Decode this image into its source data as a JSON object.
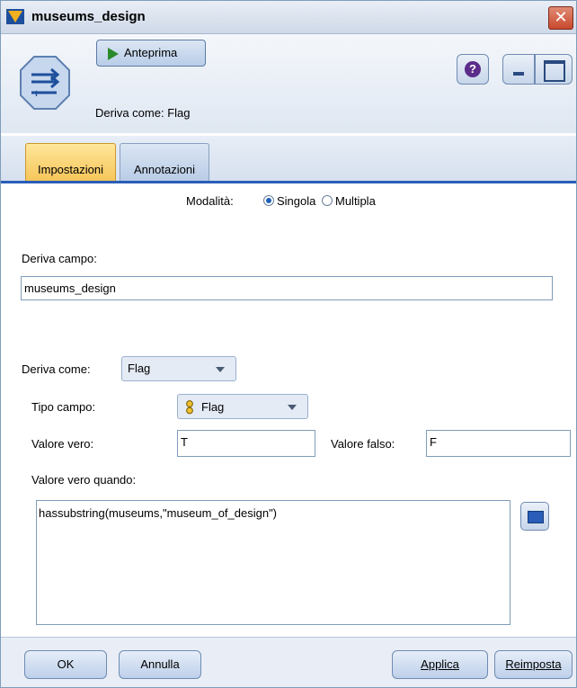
{
  "window": {
    "title": "museums_design",
    "close_symbol": "✕"
  },
  "toolbar": {
    "preview_label": "Anteprima",
    "help_symbol": "?",
    "derive_info": "Deriva come: Flag"
  },
  "tabs": [
    {
      "label": "Impostazioni",
      "active": true
    },
    {
      "label": "Annotazioni",
      "active": false
    }
  ],
  "form": {
    "mode_label": "Modalità:",
    "mode_options": [
      "Singola",
      "Multipla"
    ],
    "mode_selected": "Singola",
    "derive_field_label": "Deriva campo:",
    "derive_field_value": "museums_design",
    "derive_as_label": "Deriva come:",
    "derive_as_value": "Flag",
    "field_type_label": "Tipo campo:",
    "field_type_value": "Flag",
    "true_value_label": "Valore vero:",
    "true_value": "T",
    "false_value_label": "Valore falso:",
    "false_value": "F",
    "true_when_label": "Valore vero quando:",
    "true_when_expr": "hassubstring(museums,\"museum_of_design\")"
  },
  "buttons": {
    "ok": "OK",
    "cancel": "Annulla",
    "apply": "Applica",
    "reset": "Reimposta"
  },
  "colors": {
    "accent_tab": "#f6c65a",
    "tab_underline": "#2a5db8"
  }
}
